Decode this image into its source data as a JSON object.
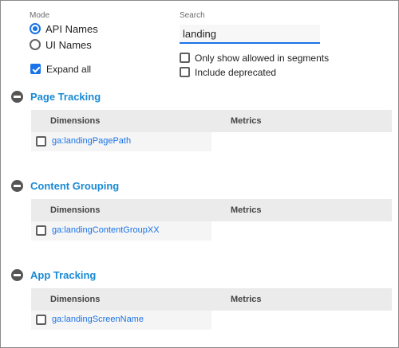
{
  "mode": {
    "label": "Mode",
    "options": [
      {
        "label": "API Names",
        "selected": true
      },
      {
        "label": "UI Names",
        "selected": false
      }
    ],
    "expand_all": {
      "label": "Expand all",
      "checked": true
    }
  },
  "search": {
    "label": "Search",
    "value": "landing",
    "filters": [
      {
        "label": "Only show allowed in segments",
        "checked": false
      },
      {
        "label": "Include deprecated",
        "checked": false
      }
    ]
  },
  "groups": [
    {
      "title": "Page Tracking",
      "dimensions_header": "Dimensions",
      "metrics_header": "Metrics",
      "dimensions": [
        {
          "name": "ga:landingPagePath",
          "checked": false
        }
      ]
    },
    {
      "title": "Content Grouping",
      "dimensions_header": "Dimensions",
      "metrics_header": "Metrics",
      "dimensions": [
        {
          "name": "ga:landingContentGroupXX",
          "checked": false
        }
      ]
    },
    {
      "title": "App Tracking",
      "dimensions_header": "Dimensions",
      "metrics_header": "Metrics",
      "dimensions": [
        {
          "name": "ga:landingScreenName",
          "checked": false
        }
      ]
    }
  ],
  "colors": {
    "accent": "#1a73e8",
    "group_title": "#1a8ad4",
    "header_bg": "#ebebeb"
  },
  "icons": {
    "collapse": "minus-circle-icon"
  }
}
